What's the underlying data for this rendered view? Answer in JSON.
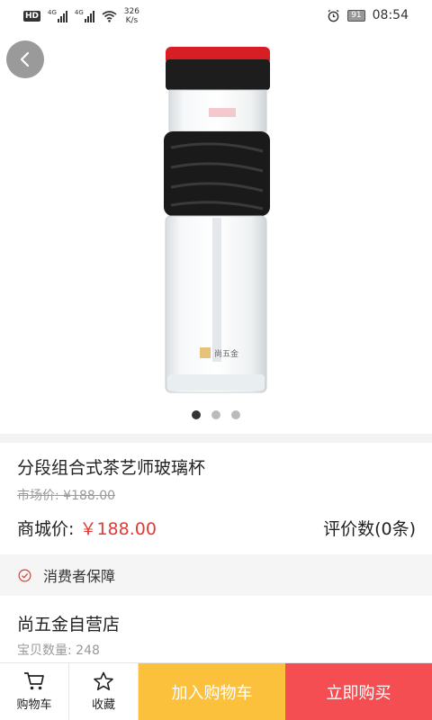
{
  "status_bar": {
    "network_type_1": "4G",
    "network_type_2": "4G",
    "speed_value": "326",
    "speed_unit": "K/s",
    "battery": "91",
    "time": "08:54"
  },
  "gallery": {
    "bottle_brand": "尚五金",
    "pages": 3,
    "active_page": 1
  },
  "product": {
    "title": "分段组合式茶艺师玻璃杯",
    "market_price": "市场价: ¥188.00",
    "mall_price_label": "商城价:",
    "mall_price": "￥188.00",
    "review_count": "评价数(0条)"
  },
  "guarantee": {
    "label": "消费者保障"
  },
  "store": {
    "name": "尚五金自营店",
    "item_count": "宝贝数量: 248"
  },
  "bottom_bar": {
    "cart_label": "购物车",
    "favorite_label": "收藏",
    "add_to_cart_label": "加入购物车",
    "buy_now_label": "立即购买"
  },
  "colors": {
    "price_red": "#e53935",
    "add_to_cart_bg": "#fcc13c",
    "buy_now_bg": "#f44e52"
  },
  "icons": [
    "back-icon",
    "cart-icon",
    "star-icon",
    "check-circle-icon",
    "alarm-icon",
    "wifi-icon"
  ]
}
